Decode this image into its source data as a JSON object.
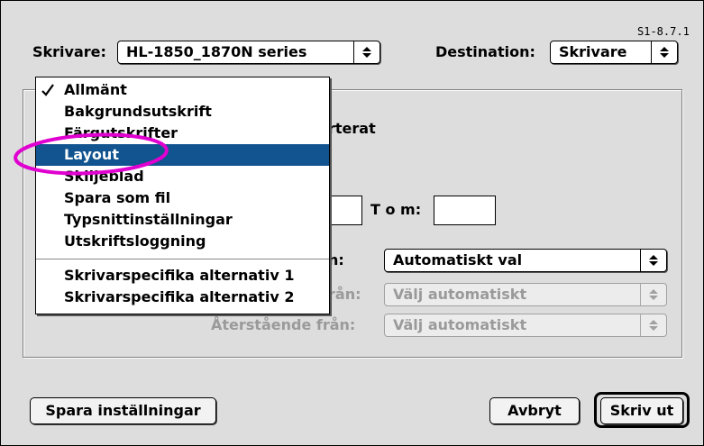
{
  "version_label": "S1-8.7.1",
  "printer": {
    "label": "Skrivare:",
    "value": "HL-1850_1870N series"
  },
  "destination": {
    "label": "Destination:",
    "value": "Skrivare"
  },
  "menu": {
    "items": [
      {
        "label": "Allmänt",
        "checked": true,
        "selected": false
      },
      {
        "label": "Bakgrundsutskrift",
        "checked": false,
        "selected": false
      },
      {
        "label": "Färgutskrifter",
        "checked": false,
        "selected": false
      },
      {
        "label": "Layout",
        "checked": false,
        "selected": true,
        "highlight_circle": "#e000d0"
      },
      {
        "label": "Skiljeblad",
        "checked": false,
        "selected": false
      },
      {
        "label": "Spara som fil",
        "checked": false,
        "selected": false
      },
      {
        "label": "Typsnittinställningar",
        "checked": false,
        "selected": false
      },
      {
        "label": "Utskriftsloggning",
        "checked": false,
        "selected": false
      }
    ],
    "extra_items": [
      {
        "label": "Skrivarspecifika alternativ 1"
      },
      {
        "label": "Skrivarspecifika alternativ 2"
      }
    ]
  },
  "panel": {
    "partial_text": "rterat",
    "to_label": "T o m:",
    "paper_source": {
      "partial_label": "n:",
      "value": "Automatiskt val"
    },
    "first_from": {
      "partial_label": "rån:",
      "value": "Välj automatiskt"
    },
    "remaining_from": {
      "label": "Återstående från:",
      "value": "Välj automatiskt"
    }
  },
  "buttons": {
    "save_settings": "Spara inställningar",
    "cancel": "Avbryt",
    "print": "Skriv ut"
  },
  "colors": {
    "selection": "#11548f",
    "highlight_circle": "#e000d0"
  }
}
